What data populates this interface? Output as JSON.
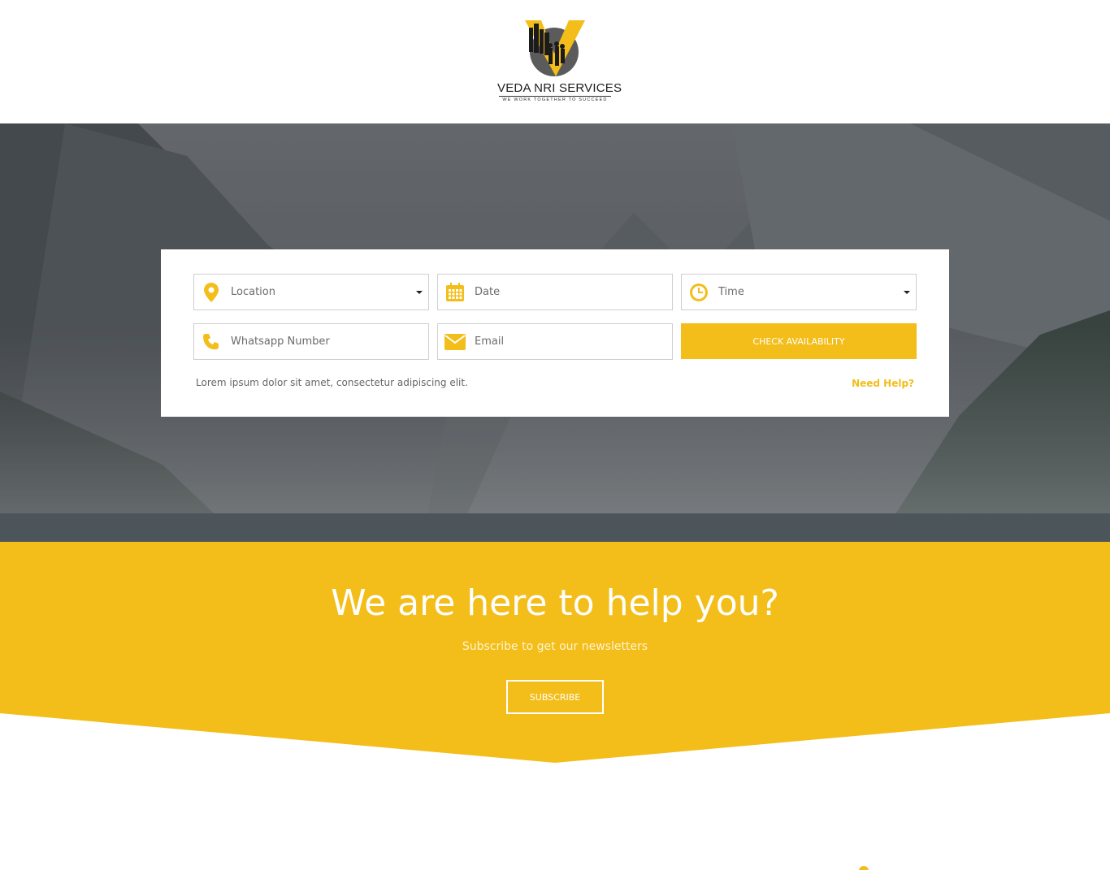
{
  "brand": {
    "name": "VEDA NRI SERVICES",
    "tagline": "WE WORK TOGETHER TO SUCCEED",
    "accent_color": "#f3bd1a",
    "logo_icon": "v-skyline-logo-icon"
  },
  "booking": {
    "location": {
      "label": "Location",
      "icon": "location-pin-icon"
    },
    "date": {
      "placeholder": "Date",
      "icon": "calendar-icon"
    },
    "time": {
      "label": "Time",
      "icon": "clock-icon"
    },
    "whatsapp": {
      "placeholder": "Whatsapp Number",
      "icon": "phone-icon"
    },
    "email": {
      "placeholder": "Email",
      "icon": "envelope-icon"
    },
    "check_label": "CHECK AVAILABILITY",
    "note": "Lorem ipsum dolor sit amet, consectetur adipiscing elit.",
    "help_label": "Need Help?"
  },
  "newsletter": {
    "title": "We are here to help you?",
    "subtitle": "Subscribe to get our newsletters",
    "button_label": "SUBSCRIBE"
  }
}
